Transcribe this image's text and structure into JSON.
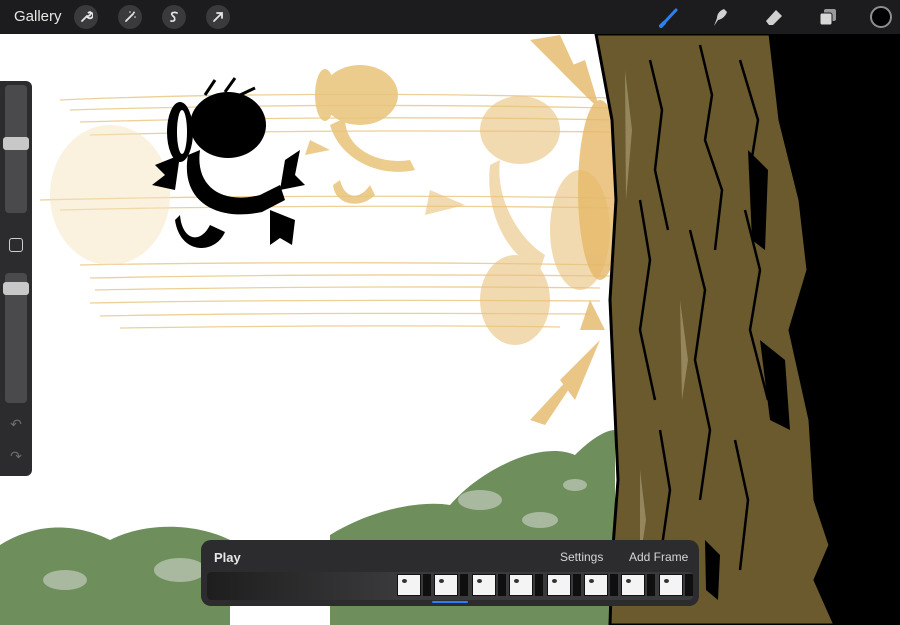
{
  "app": {
    "gallery_label": "Gallery"
  },
  "toolbar": {
    "left_tools": [
      {
        "name": "actions-wrench-icon"
      },
      {
        "name": "adjustments-wand-icon"
      },
      {
        "name": "selection-s-icon"
      },
      {
        "name": "transform-arrow-icon"
      }
    ],
    "right_tools": [
      {
        "name": "brush-icon",
        "active": true
      },
      {
        "name": "smudge-icon",
        "active": false
      },
      {
        "name": "eraser-icon",
        "active": false
      },
      {
        "name": "layers-icon",
        "active": false
      }
    ],
    "current_color": "#000000",
    "active_tool_color": "#2f80ed"
  },
  "sidebar": {
    "brush_size_level": 0.55,
    "opacity_level": 0.92
  },
  "animation": {
    "play_label": "Play",
    "settings_label": "Settings",
    "add_frame_label": "Add Frame",
    "frames": [
      {
        "id": 1
      },
      {
        "id": 2,
        "active": true
      },
      {
        "id": 3
      },
      {
        "id": 4
      },
      {
        "id": 5
      },
      {
        "id": 6
      },
      {
        "id": 7
      },
      {
        "id": 8
      }
    ],
    "highlight_color": "#2e7cf6"
  },
  "colors": {
    "onion_skin": "#e8c178",
    "trunk": "#6b5a2e",
    "bush": "#6e8f5c"
  }
}
